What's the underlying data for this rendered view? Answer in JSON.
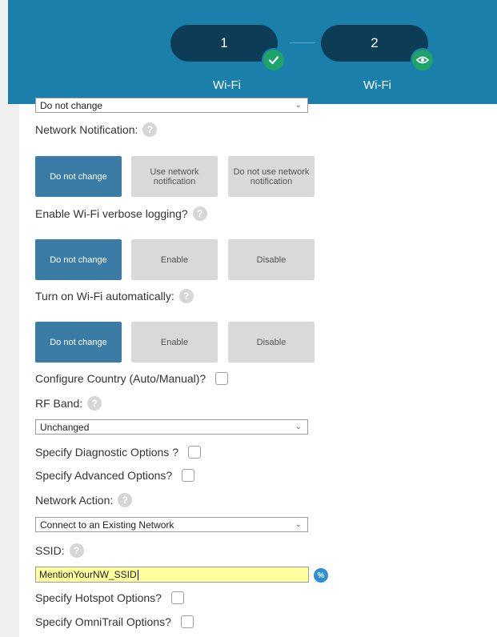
{
  "wizard": {
    "steps": [
      {
        "number": "1",
        "label": "Wi-Fi",
        "badge_icon": "check-icon"
      },
      {
        "number": "2",
        "label": "Wi-Fi",
        "badge_icon": "eye-icon"
      }
    ]
  },
  "top_select": {
    "value": "Do not change"
  },
  "network_notification": {
    "label": "Network Notification:",
    "options": [
      "Do not change",
      "Use network notification",
      "Do not use network notification"
    ],
    "selected_index": 0
  },
  "verbose_logging": {
    "label": "Enable Wi-Fi verbose logging?",
    "options": [
      "Do not change",
      "Enable",
      "Disable"
    ],
    "selected_index": 0
  },
  "wifi_auto": {
    "label": "Turn on Wi-Fi automatically:",
    "options": [
      "Do not change",
      "Enable",
      "Disable"
    ],
    "selected_index": 0
  },
  "configure_country": {
    "label": "Configure Country (Auto/Manual)?",
    "checked": false
  },
  "rf_band": {
    "label": "RF Band:",
    "value": "Unchanged"
  },
  "diagnostic_options": {
    "label": "Specify Diagnostic Options ?",
    "checked": false
  },
  "advanced_options": {
    "label": "Specify Advanced Options?",
    "checked": false
  },
  "network_action": {
    "label": "Network Action:",
    "value": "Connect to an Existing Network"
  },
  "ssid": {
    "label": "SSID:",
    "value": "MentionYourNW_SSID"
  },
  "hotspot_options": {
    "label": "Specify Hotspot Options?",
    "checked": false
  },
  "omnitrail_options": {
    "label": "Specify OmniTrail Options?",
    "checked": false
  },
  "colors": {
    "header_bg": "#1b7fab",
    "step_pill": "#0d3d56",
    "badge_green": "#1ea36a",
    "selected_button": "#3a7ca5",
    "unselected_button": "#d9d9d9",
    "ssid_highlight": "#ffff9e"
  }
}
